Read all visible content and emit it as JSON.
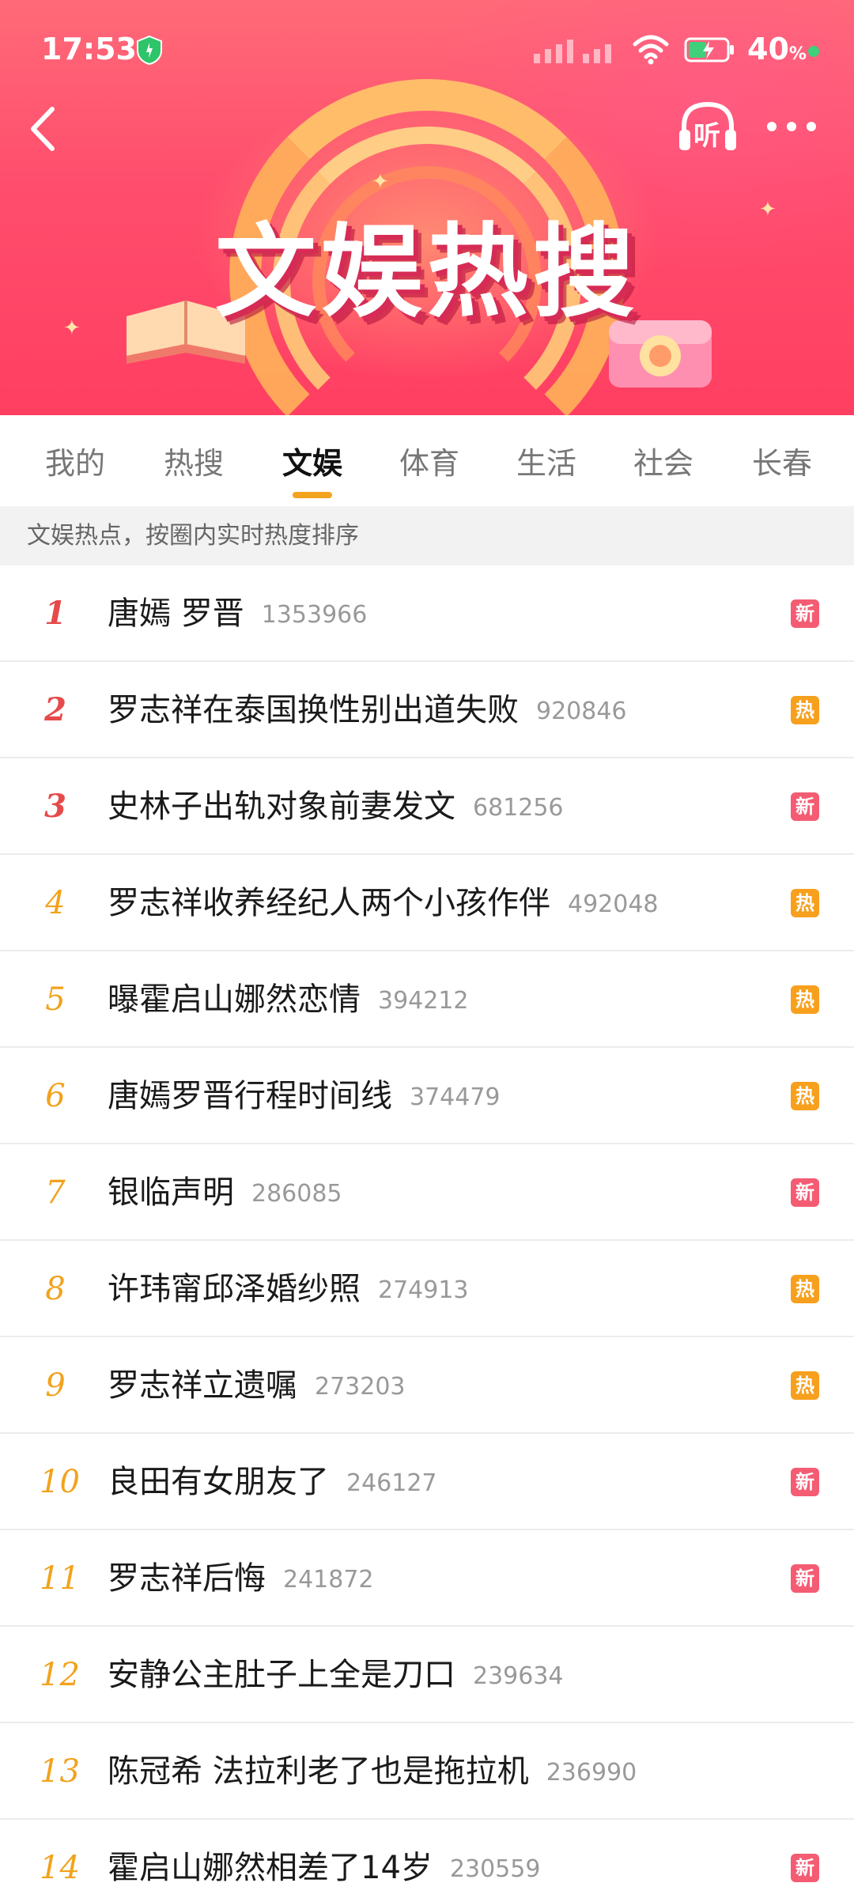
{
  "status_bar": {
    "time": "17:53",
    "battery_percent": "40",
    "battery_unit": "%"
  },
  "header": {
    "banner_title": "文娱热搜",
    "listen_label": "听",
    "accent_colors": {
      "top_rank": "#e64a4a",
      "rank": "#f2a21c",
      "new_badge": "#f45c73",
      "hot_badge": "#f7a01d"
    }
  },
  "tabs": [
    {
      "label": "我的"
    },
    {
      "label": "热搜"
    },
    {
      "label": "文娱"
    },
    {
      "label": "体育"
    },
    {
      "label": "生活"
    },
    {
      "label": "社会"
    },
    {
      "label": "长春"
    }
  ],
  "active_tab": "文娱",
  "subheader": "文娱热点，按圈内实时热度排序",
  "items": [
    {
      "rank": "1",
      "title": "唐嫣 罗晋",
      "score": "1353966",
      "badge": "新"
    },
    {
      "rank": "2",
      "title": "罗志祥在泰国换性别出道失败",
      "score": "920846",
      "badge": "热"
    },
    {
      "rank": "3",
      "title": "史林子出轨对象前妻发文",
      "score": "681256",
      "badge": "新"
    },
    {
      "rank": "4",
      "title": "罗志祥收养经纪人两个小孩作伴",
      "score": "492048",
      "badge": "热"
    },
    {
      "rank": "5",
      "title": "曝霍启山娜然恋情",
      "score": "394212",
      "badge": "热"
    },
    {
      "rank": "6",
      "title": "唐嫣罗晋行程时间线",
      "score": "374479",
      "badge": "热"
    },
    {
      "rank": "7",
      "title": "银临声明",
      "score": "286085",
      "badge": "新"
    },
    {
      "rank": "8",
      "title": "许玮甯邱泽婚纱照",
      "score": "274913",
      "badge": "热"
    },
    {
      "rank": "9",
      "title": "罗志祥立遗嘱",
      "score": "273203",
      "badge": "热"
    },
    {
      "rank": "10",
      "title": "良田有女朋友了",
      "score": "246127",
      "badge": "新"
    },
    {
      "rank": "11",
      "title": "罗志祥后悔",
      "score": "241872",
      "badge": "新"
    },
    {
      "rank": "12",
      "title": "安静公主肚子上全是刀口",
      "score": "239634",
      "badge": ""
    },
    {
      "rank": "13",
      "title": "陈冠希 法拉利老了也是拖拉机",
      "score": "236990",
      "badge": ""
    },
    {
      "rank": "14",
      "title": "霍启山娜然相差了14岁",
      "score": "230559",
      "badge": "新"
    }
  ]
}
